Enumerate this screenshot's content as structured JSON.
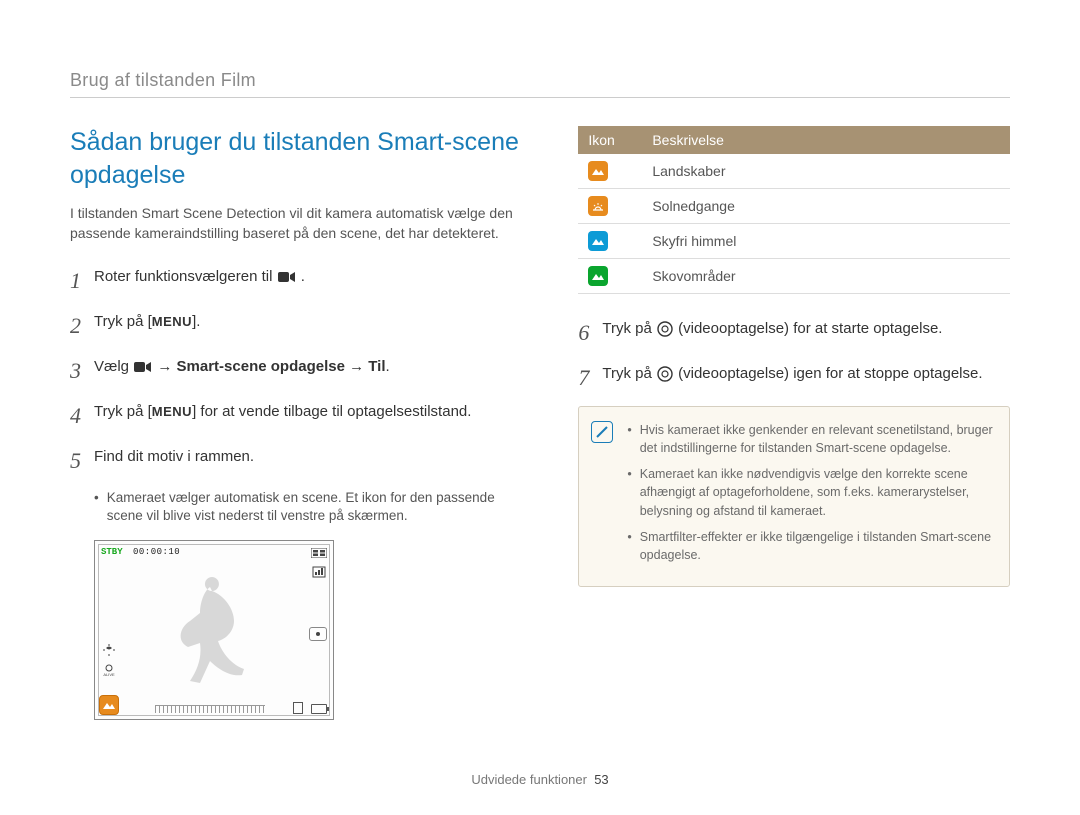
{
  "breadcrumb": "Brug af tilstanden Film",
  "title": "Sådan bruger du tilstanden Smart-scene opdagelse",
  "intro": "I tilstanden Smart Scene Detection vil dit kamera automatisk vælge den passende kameraindstilling baseret på den scene, det har detekteret.",
  "steps_left": {
    "s1": "Roter funktionsvælgeren til ",
    "s1_end": ".",
    "s2_a": "Tryk på [",
    "s2_menu": "MENU",
    "s2_b": "].",
    "s3_a": "Vælg ",
    "s3_arrow": " → ",
    "s3_bold": "Smart-scene opdagelse",
    "s3_arrow2": " → ",
    "s3_til": "Til",
    "s3_end": ".",
    "s4_a": "Tryk på [",
    "s4_menu": "MENU",
    "s4_b": "] for at vende tilbage til optagelsestilstand.",
    "s5": "Find dit motiv i rammen.",
    "s5_note": "Kameraet vælger automatisk en scene. Et ikon for den passende scene vil blive vist nederst til venstre på skærmen."
  },
  "preview": {
    "stby": "STBY",
    "timecode": "00:00:10"
  },
  "table": {
    "h1": "Ikon",
    "h2": "Beskrivelse",
    "rows": [
      {
        "label": "Landskaber",
        "color": "si-orange"
      },
      {
        "label": "Solnedgange",
        "color": "si-orange"
      },
      {
        "label": "Skyfri himmel",
        "color": "si-blue"
      },
      {
        "label": "Skovområder",
        "color": "si-green"
      }
    ]
  },
  "steps_right": {
    "s6_a": "Tryk på ",
    "s6_b": " (videooptagelse) for at starte optagelse.",
    "s7_a": "Tryk på ",
    "s7_b": " (videooptagelse) igen for at stoppe optagelse."
  },
  "notes": [
    "Hvis kameraet ikke genkender en relevant scenetilstand, bruger det indstillingerne for tilstanden Smart-scene opdagelse.",
    "Kameraet kan ikke nødvendigvis vælge den korrekte scene afhængigt af optageforholdene, som f.eks. kamerarystelser, belysning og afstand til kameraet.",
    "Smartfilter-effekter er ikke tilgængelige i tilstanden Smart-scene opdagelse."
  ],
  "footer": {
    "section": "Udvidede funktioner",
    "page": "53"
  }
}
